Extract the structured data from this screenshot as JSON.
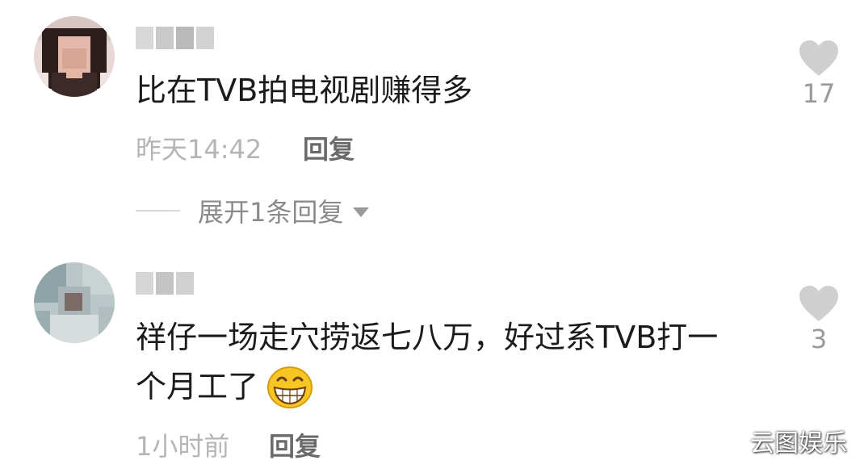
{
  "comments": [
    {
      "text": "比在TVB拍电视剧赚得多",
      "time": "昨天14:42",
      "reply_label": "回复",
      "likes": "17",
      "expand_label": "展开1条回复"
    },
    {
      "text_line1": "祥仔一场走穴捞返七八万，好过系TVB打一",
      "text_line2": "个月工了",
      "emoji": "grinning-face",
      "time": "1小时前",
      "reply_label": "回复",
      "likes": "3"
    }
  ],
  "watermark": "云图娱乐",
  "colors": {
    "text": "#1b1b1b",
    "meta": "#b5b5b5",
    "reply": "#6a6a6a",
    "heart": "#cfcfcf"
  }
}
